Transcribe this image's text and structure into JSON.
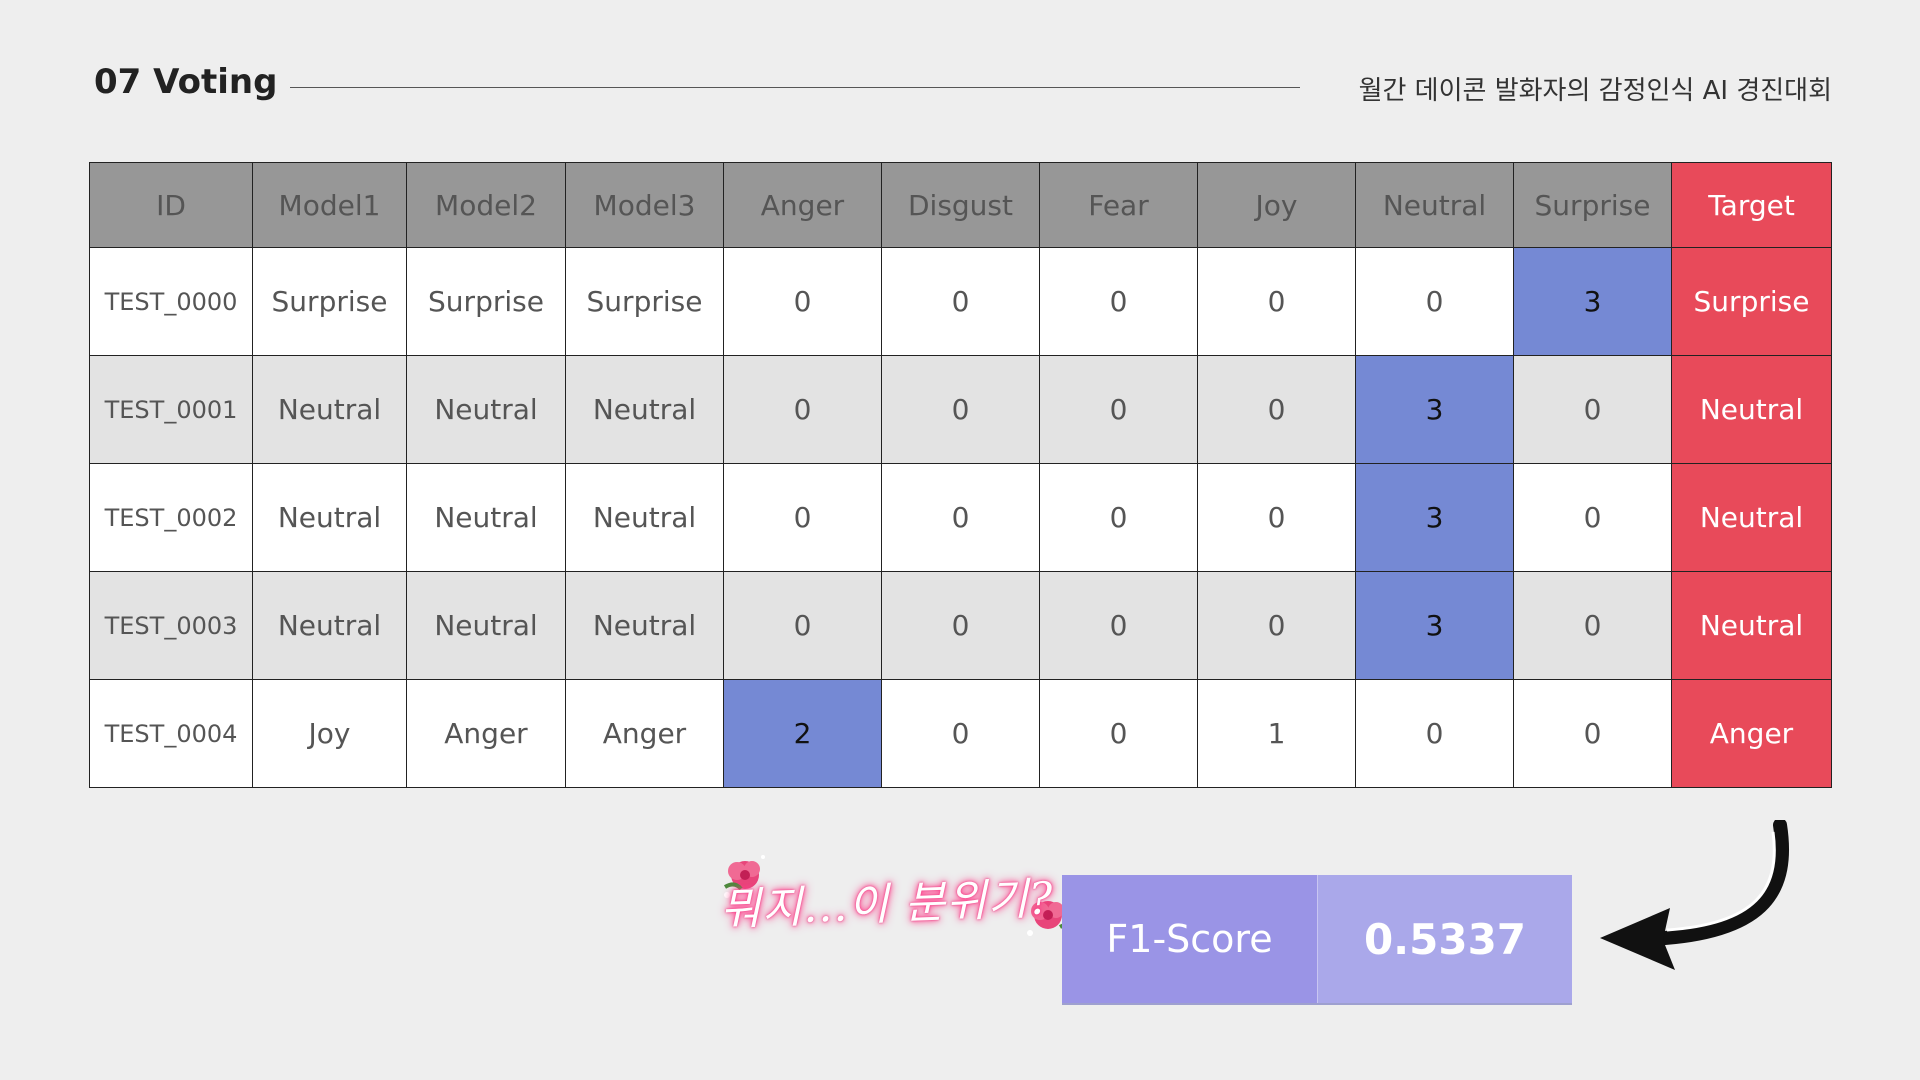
{
  "header": {
    "title": "07 Voting",
    "subtitle": "월간 데이콘 발화자의 감정인식 AI 경진대회"
  },
  "table": {
    "columns": [
      "ID",
      "Model1",
      "Model2",
      "Model3",
      "Anger",
      "Disgust",
      "Fear",
      "Joy",
      "Neutral",
      "Surprise",
      "Target"
    ],
    "rows": [
      [
        "TEST_0000",
        "Surprise",
        "Surprise",
        "Surprise",
        "0",
        "0",
        "0",
        "0",
        "0",
        "3",
        "Surprise"
      ],
      [
        "TEST_0001",
        "Neutral",
        "Neutral",
        "Neutral",
        "0",
        "0",
        "0",
        "0",
        "3",
        "0",
        "Neutral"
      ],
      [
        "TEST_0002",
        "Neutral",
        "Neutral",
        "Neutral",
        "0",
        "0",
        "0",
        "0",
        "3",
        "0",
        "Neutral"
      ],
      [
        "TEST_0003",
        "Neutral",
        "Neutral",
        "Neutral",
        "0",
        "0",
        "0",
        "0",
        "3",
        "0",
        "Neutral"
      ],
      [
        "TEST_0004",
        "Joy",
        "Anger",
        "Anger",
        "2",
        "0",
        "0",
        "1",
        "0",
        "0",
        "Anger"
      ]
    ],
    "highlight_color": "#7589d4",
    "target_color": "#e84a5a"
  },
  "tagline": "뭐지...이 분위기?",
  "score": {
    "label": "F1-Score",
    "value": "0.5337"
  },
  "icons": [
    "rose-icon",
    "curved-arrow-icon"
  ]
}
